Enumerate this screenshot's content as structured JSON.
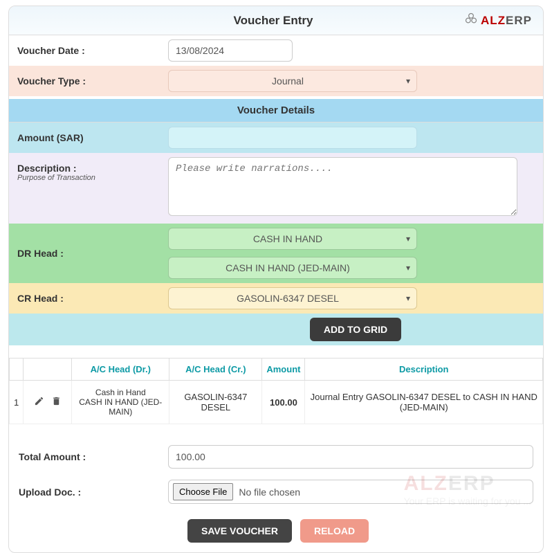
{
  "header": {
    "title": "Voucher Entry",
    "logo": "ALZERP"
  },
  "form": {
    "voucher_date_label": "Voucher Date :",
    "voucher_date_value": "13/08/2024",
    "voucher_type_label": "Voucher Type :",
    "voucher_type_value": "Journal",
    "details_header": "Voucher Details",
    "amount_label": "Amount (SAR)",
    "amount_value": "",
    "description_label": "Description :",
    "description_sub": "Purpose of Transaction",
    "description_placeholder": "Please write narrations....",
    "dr_head_label": "DR Head :",
    "dr_head_value": "CASH IN HAND",
    "dr_head_sub_value": "CASH IN HAND (JED-MAIN)",
    "cr_head_label": "CR Head :",
    "cr_head_value": "GASOLIN-6347 DESEL",
    "add_to_grid": "ADD TO GRID"
  },
  "grid": {
    "columns": [
      "",
      "",
      "A/C Head (Dr.)",
      "A/C Head (Cr.)",
      "Amount",
      "Description"
    ],
    "rows": [
      {
        "idx": "1",
        "dr_line1": "Cash in Hand",
        "dr_line2": "CASH IN HAND (JED-MAIN)",
        "cr": "GASOLIN-6347 DESEL",
        "amount": "100.00",
        "desc": "Journal Entry GASOLIN-6347 DESEL to CASH IN HAND (JED-MAIN)"
      }
    ]
  },
  "bottom": {
    "total_label": "Total Amount :",
    "total_value": "100.00",
    "upload_label": "Upload Doc. :",
    "choose_file": "Choose File",
    "no_file": "No file chosen",
    "save": "SAVE VOUCHER",
    "reload": "RELOAD"
  },
  "watermark": {
    "text": "ALZERP",
    "tag": "Your ERP is waiting for you ..."
  }
}
